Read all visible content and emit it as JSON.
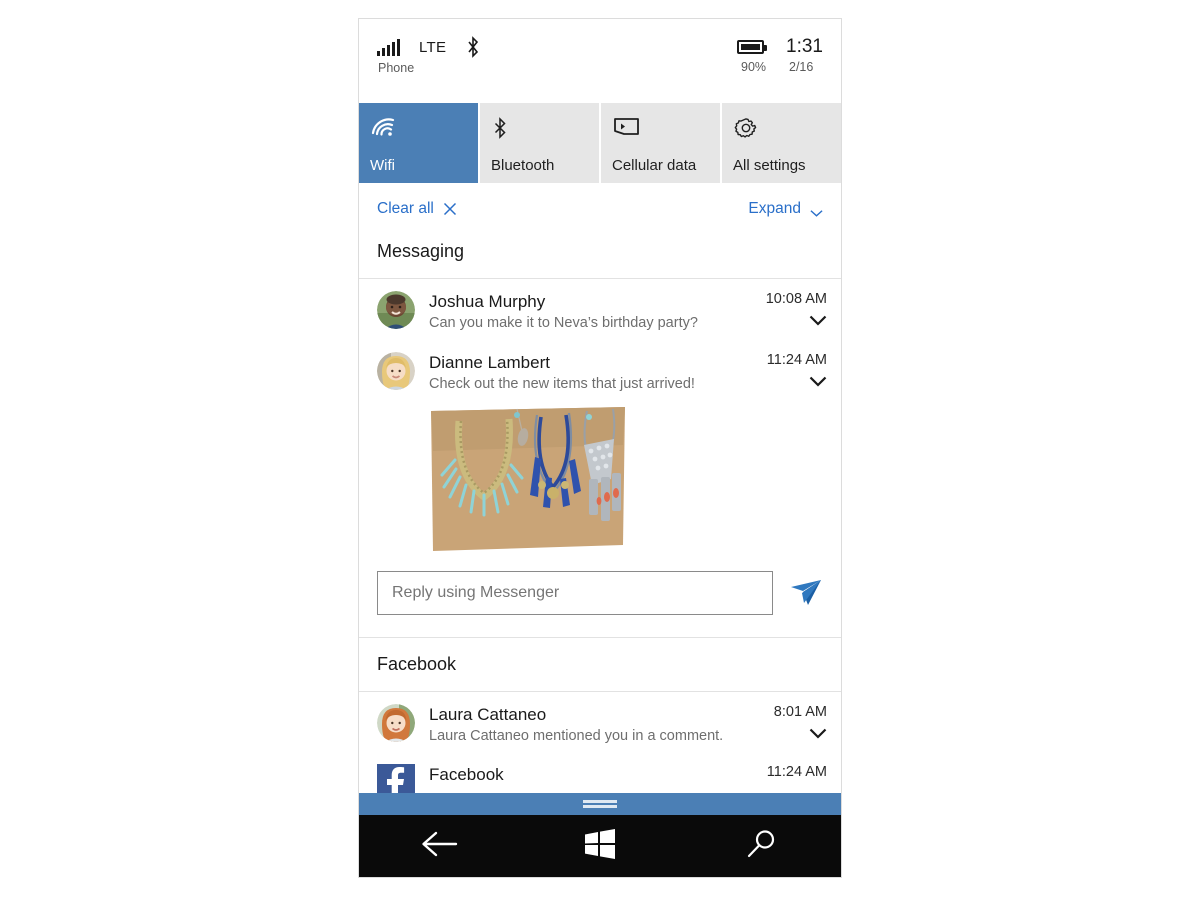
{
  "status_bar": {
    "signal_icon": "signal-bars-icon",
    "network_label": "LTE",
    "bluetooth_icon": "bluetooth-icon",
    "carrier_label": "Phone",
    "battery_icon": "battery-icon",
    "battery_percent": "90%",
    "time": "1:31",
    "date": "2/16"
  },
  "quick_actions": {
    "tiles": [
      {
        "label": "Wifi",
        "icon": "wifi-icon",
        "active": true
      },
      {
        "label": "Bluetooth",
        "icon": "bluetooth-icon",
        "active": false
      },
      {
        "label": "Cellular data",
        "icon": "cellular-data-icon",
        "active": false
      },
      {
        "label": "All settings",
        "icon": "gear-icon",
        "active": false
      }
    ],
    "active_color": "#4b7fb5",
    "inactive_color": "#e6e6e6"
  },
  "actions": {
    "clear_all_label": "Clear all",
    "clear_all_icon": "close-x-icon",
    "expand_label": "Expand",
    "expand_icon": "chevron-down-icon",
    "link_color": "#2a6fc9"
  },
  "groups": [
    {
      "header": "Messaging",
      "notifications": [
        {
          "title": "Joshua Murphy",
          "body": "Can you make it to Neva’s birthday party?",
          "time": "10:08 AM",
          "avatar": "avatar-joshua-murphy",
          "expander": "chevron-down-icon"
        },
        {
          "title": "Dianne Lambert",
          "body": "Check out the new items that just arrived!",
          "time": "11:24 AM",
          "avatar": "avatar-dianne-lambert",
          "expander": "chevron-down-icon",
          "attachment": "jewelry-necklaces-photo"
        }
      ],
      "reply": {
        "placeholder": "Reply using Messenger",
        "value": "",
        "send_icon": "send-paper-plane-icon",
        "send_color": "#2a72bd"
      }
    },
    {
      "header": "Facebook",
      "notifications": [
        {
          "title": "Laura Cattaneo",
          "body": "Laura Cattaneo mentioned you in a comment.",
          "time": "8:01 AM",
          "avatar": "avatar-laura-cattaneo",
          "expander": "chevron-down-icon"
        },
        {
          "title": "Facebook",
          "body": "",
          "time": "11:24 AM",
          "avatar": "facebook-app-icon",
          "expander": ""
        }
      ]
    }
  ],
  "drag_handle": {
    "icon": "drag-grip-icon",
    "color": "#4b7fb5"
  },
  "nav_bar": {
    "buttons": [
      {
        "name": "back",
        "icon": "back-arrow-icon"
      },
      {
        "name": "start",
        "icon": "windows-logo-icon"
      },
      {
        "name": "search",
        "icon": "search-magnifier-icon"
      }
    ],
    "background": "#0a0a0a"
  }
}
